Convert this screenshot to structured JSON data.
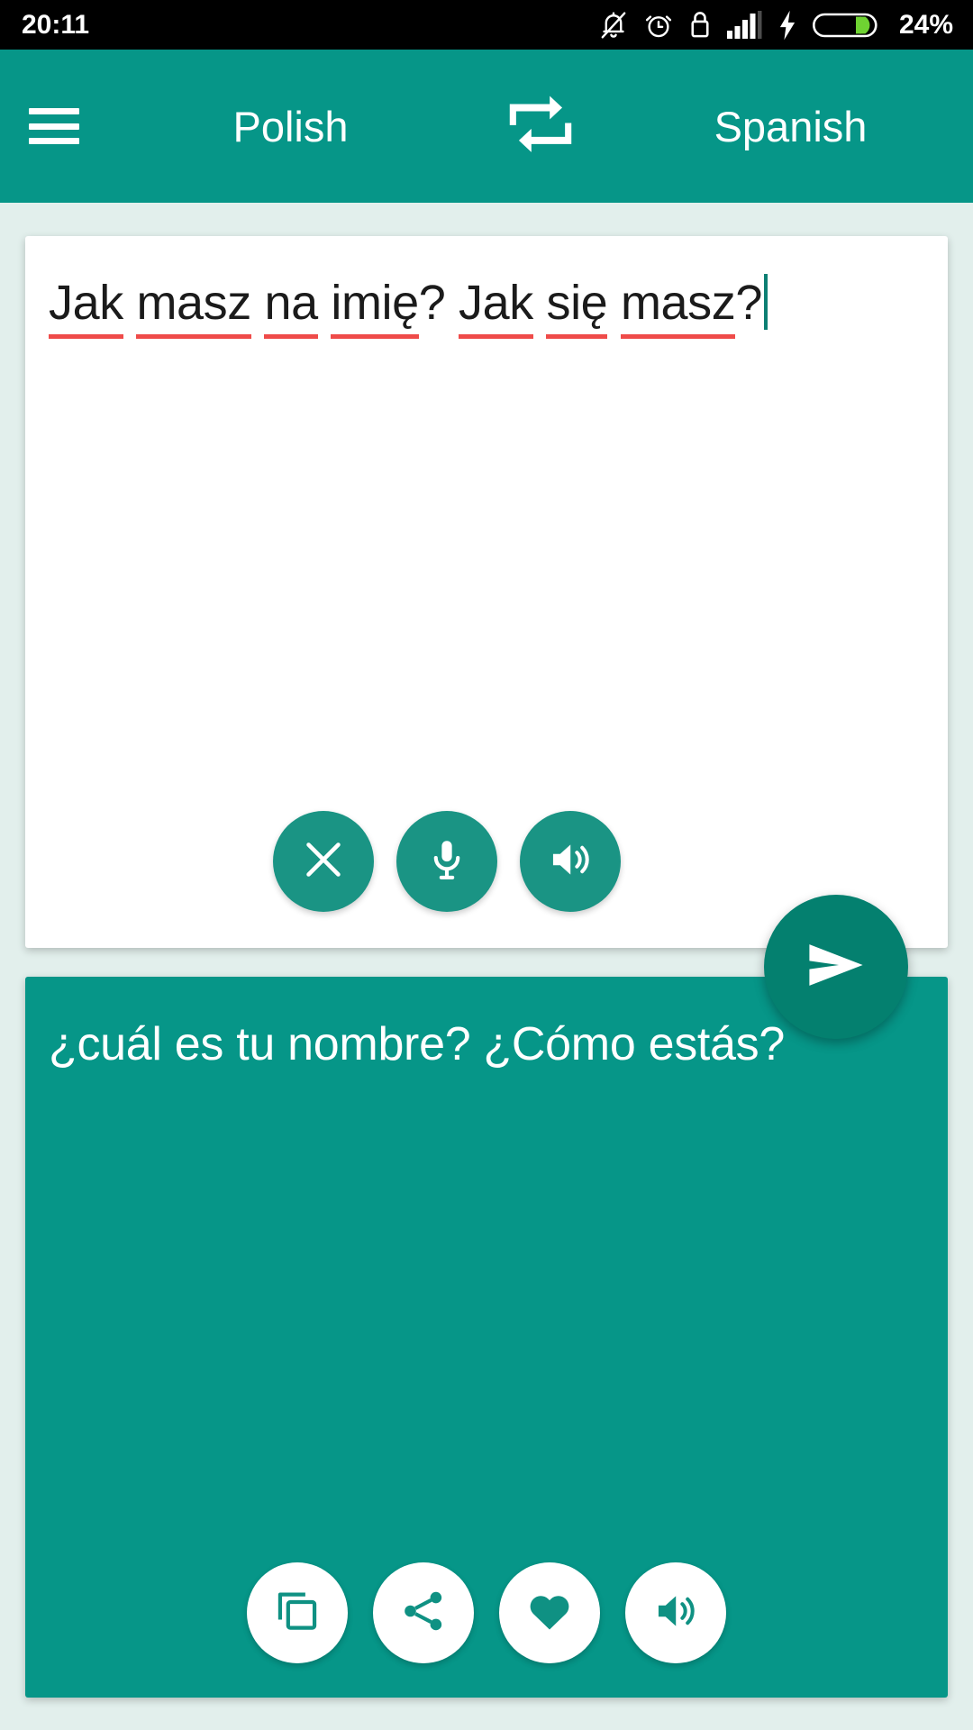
{
  "status_bar": {
    "time": "20:11",
    "battery_percent": "24%",
    "icons": [
      "bell-off-icon",
      "alarm-clock-icon",
      "usb-lock-icon",
      "signal-bars-icon",
      "charging-bolt-icon",
      "battery-icon"
    ]
  },
  "app_bar": {
    "menu_label": "menu",
    "source_language": "Polish",
    "target_language": "Spanish",
    "swap_label": "swap languages"
  },
  "input_card": {
    "text": "Jak masz na imię? Jak się masz?",
    "words": [
      {
        "text": "Jak",
        "misspelled": true
      },
      {
        "text": "masz",
        "misspelled": true
      },
      {
        "text": "na",
        "misspelled": true
      },
      {
        "text": "imię",
        "misspelled": true
      },
      {
        "text": "?",
        "misspelled": false
      },
      {
        "text": "Jak",
        "misspelled": true
      },
      {
        "text": "się",
        "misspelled": true
      },
      {
        "text": "masz",
        "misspelled": true
      },
      {
        "text": "?",
        "misspelled": false
      }
    ],
    "actions": [
      {
        "name": "clear-button",
        "icon": "close-icon"
      },
      {
        "name": "microphone-button",
        "icon": "microphone-icon"
      },
      {
        "name": "speak-source-button",
        "icon": "speaker-icon"
      }
    ]
  },
  "send_button": {
    "name": "send-button",
    "icon": "send-icon"
  },
  "output_card": {
    "text": "¿cuál es tu nombre? ¿Cómo estás?",
    "actions": [
      {
        "name": "copy-button",
        "icon": "copy-icon"
      },
      {
        "name": "share-button",
        "icon": "share-icon"
      },
      {
        "name": "favorite-button",
        "icon": "heart-icon"
      },
      {
        "name": "speak-target-button",
        "icon": "speaker-icon"
      }
    ]
  },
  "colors": {
    "primary_teal": "#069688",
    "dark_teal": "#04806f",
    "button_teal": "#1a9484",
    "page_background": "#e2efec",
    "spellcheck_red": "#ef4b49",
    "battery_green": "#6fd332"
  }
}
